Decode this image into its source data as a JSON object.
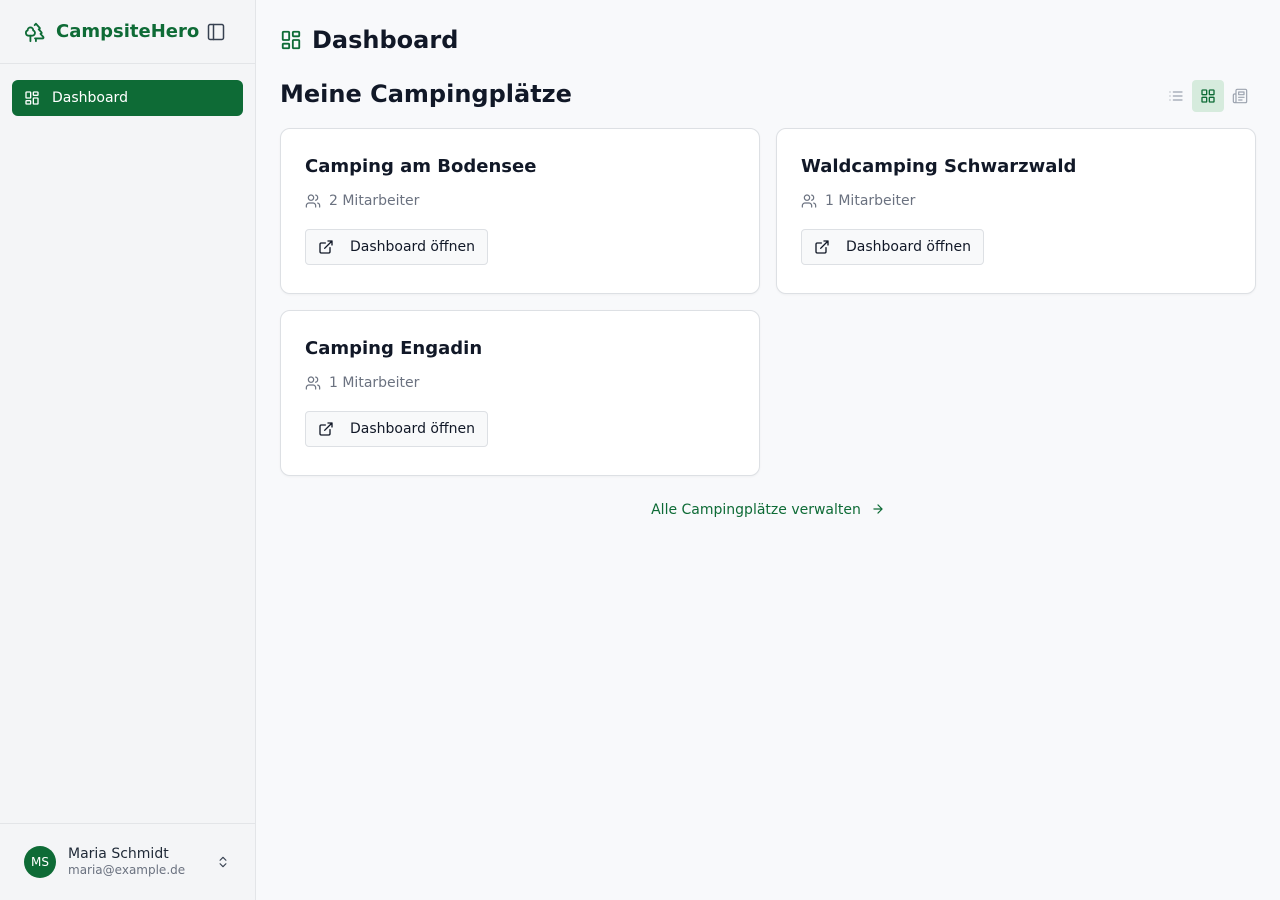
{
  "app": {
    "brand": "CampsiteHero",
    "brand_color": "#0e6b36"
  },
  "sidebar": {
    "items": [
      {
        "label": "Dashboard",
        "icon": "dashboard-icon",
        "active": true
      }
    ],
    "user": {
      "initials": "MS",
      "name": "Maria Schmidt",
      "email": "maria@example.de"
    }
  },
  "main": {
    "title": "Dashboard",
    "section_title": "Meine Campingplätze",
    "view_modes": [
      {
        "name": "list",
        "icon": "list-icon",
        "active": false
      },
      {
        "name": "grid",
        "icon": "grid-icon",
        "active": true
      },
      {
        "name": "detail",
        "icon": "newspaper-icon",
        "active": false
      }
    ],
    "campsites": [
      {
        "name": "Camping am Bodensee",
        "staff": "2 Mitarbeiter",
        "button": "Dashboard öffnen"
      },
      {
        "name": "Waldcamping Schwarzwald",
        "staff": "1 Mitarbeiter",
        "button": "Dashboard öffnen"
      },
      {
        "name": "Camping Engadin",
        "staff": "1 Mitarbeiter",
        "button": "Dashboard öffnen"
      }
    ],
    "manage_link": "Alle Campingplätze verwalten"
  }
}
